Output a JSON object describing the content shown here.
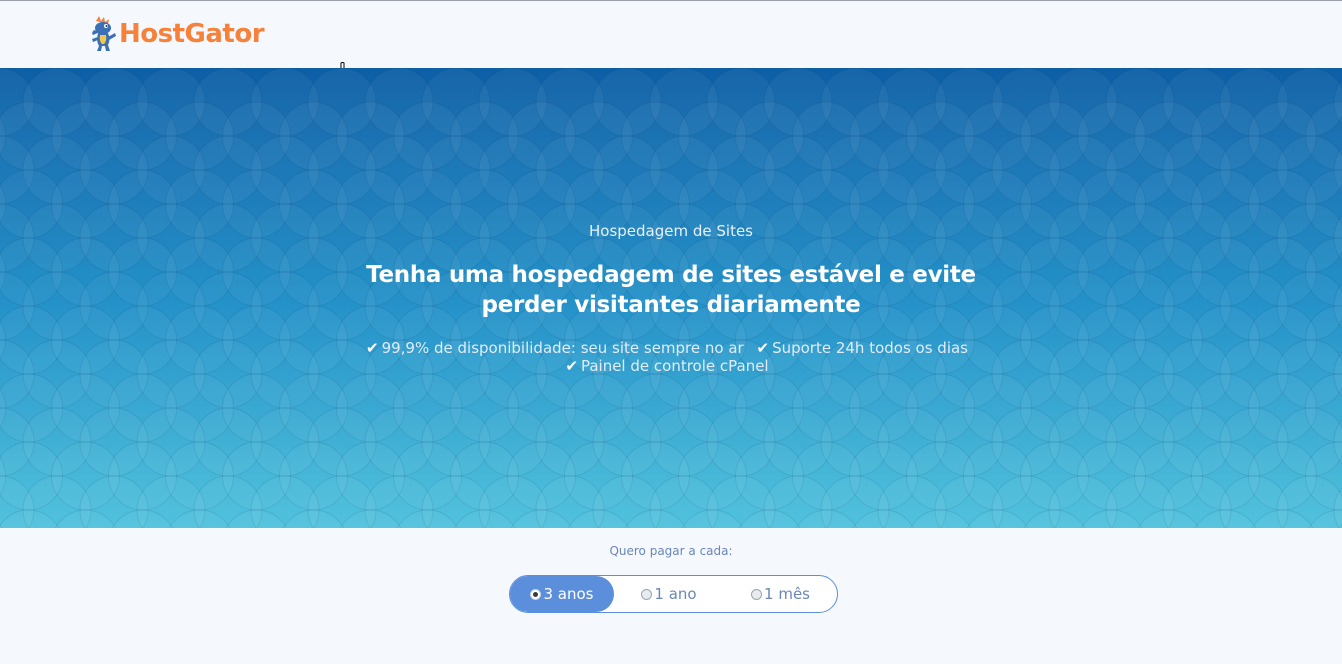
{
  "header": {
    "logo_text": "HostGator",
    "logo_color": "#f6813b"
  },
  "hero": {
    "eyebrow": "Hospedagem de Sites",
    "headline": "Tenha uma hospedagem de sites estável e evite perder visitantes diariamente",
    "features": [
      {
        "icon": "check-icon",
        "text": "99,9% de disponibilidade: seu site sempre no ar"
      },
      {
        "icon": "check-icon",
        "text": "Suporte 24h todos os dias"
      },
      {
        "icon": "check-icon",
        "text": "Painel de controle cPanel"
      }
    ],
    "colors": {
      "top": "#0d5fa6",
      "bottom": "#4ac0dc"
    }
  },
  "billing": {
    "label": "Quero pagar a cada:",
    "options": [
      {
        "label": "3 anos",
        "selected": true
      },
      {
        "label": "1 ano",
        "selected": false
      },
      {
        "label": "1 mês",
        "selected": false
      }
    ],
    "accent": "#5b8fdb"
  }
}
